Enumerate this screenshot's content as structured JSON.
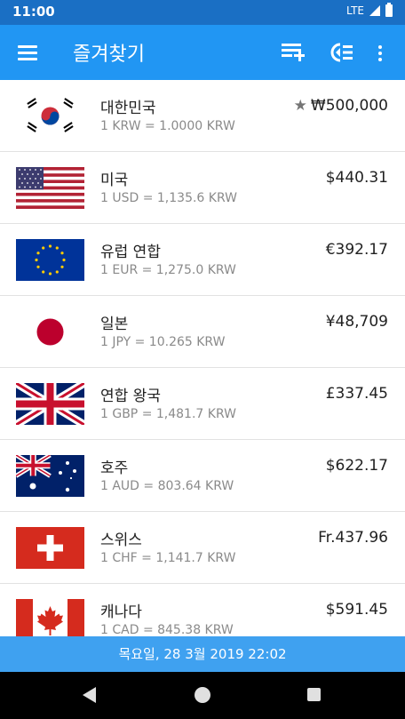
{
  "status_bar": {
    "time": "11:00",
    "network": "LTE"
  },
  "app_bar": {
    "title": "즐겨찾기"
  },
  "currencies": [
    {
      "flag": "south-korea-flag",
      "country": "대한민국",
      "rate": "1 KRW = 1.0000 KRW",
      "amount": "₩500,000",
      "base": true
    },
    {
      "flag": "united-states-flag",
      "country": "미국",
      "rate": "1 USD = 1,135.6 KRW",
      "amount": "$440.31"
    },
    {
      "flag": "european-union-flag",
      "country": "유럽 연합",
      "rate": "1 EUR = 1,275.0 KRW",
      "amount": "€392.17"
    },
    {
      "flag": "japan-flag",
      "country": "일본",
      "rate": "1 JPY = 10.265 KRW",
      "amount": "¥48,709"
    },
    {
      "flag": "united-kingdom-flag",
      "country": "연합 왕국",
      "rate": "1 GBP = 1,481.7 KRW",
      "amount": "£337.45"
    },
    {
      "flag": "australia-flag",
      "country": "호주",
      "rate": "1 AUD = 803.64 KRW",
      "amount": "$622.17"
    },
    {
      "flag": "switzerland-flag",
      "country": "스위스",
      "rate": "1 CHF = 1,141.7 KRW",
      "amount": "Fr.437.96"
    },
    {
      "flag": "canada-flag",
      "country": "캐나다",
      "rate": "1 CAD = 845.38 KRW",
      "amount": "$591.45"
    }
  ],
  "footer": {
    "date": "목요일, 28 3월 2019 22:02"
  },
  "colors": {
    "status_bar": "#1a6fc4",
    "app_bar": "#2196f3",
    "date_bar": "#3fa1f0"
  }
}
